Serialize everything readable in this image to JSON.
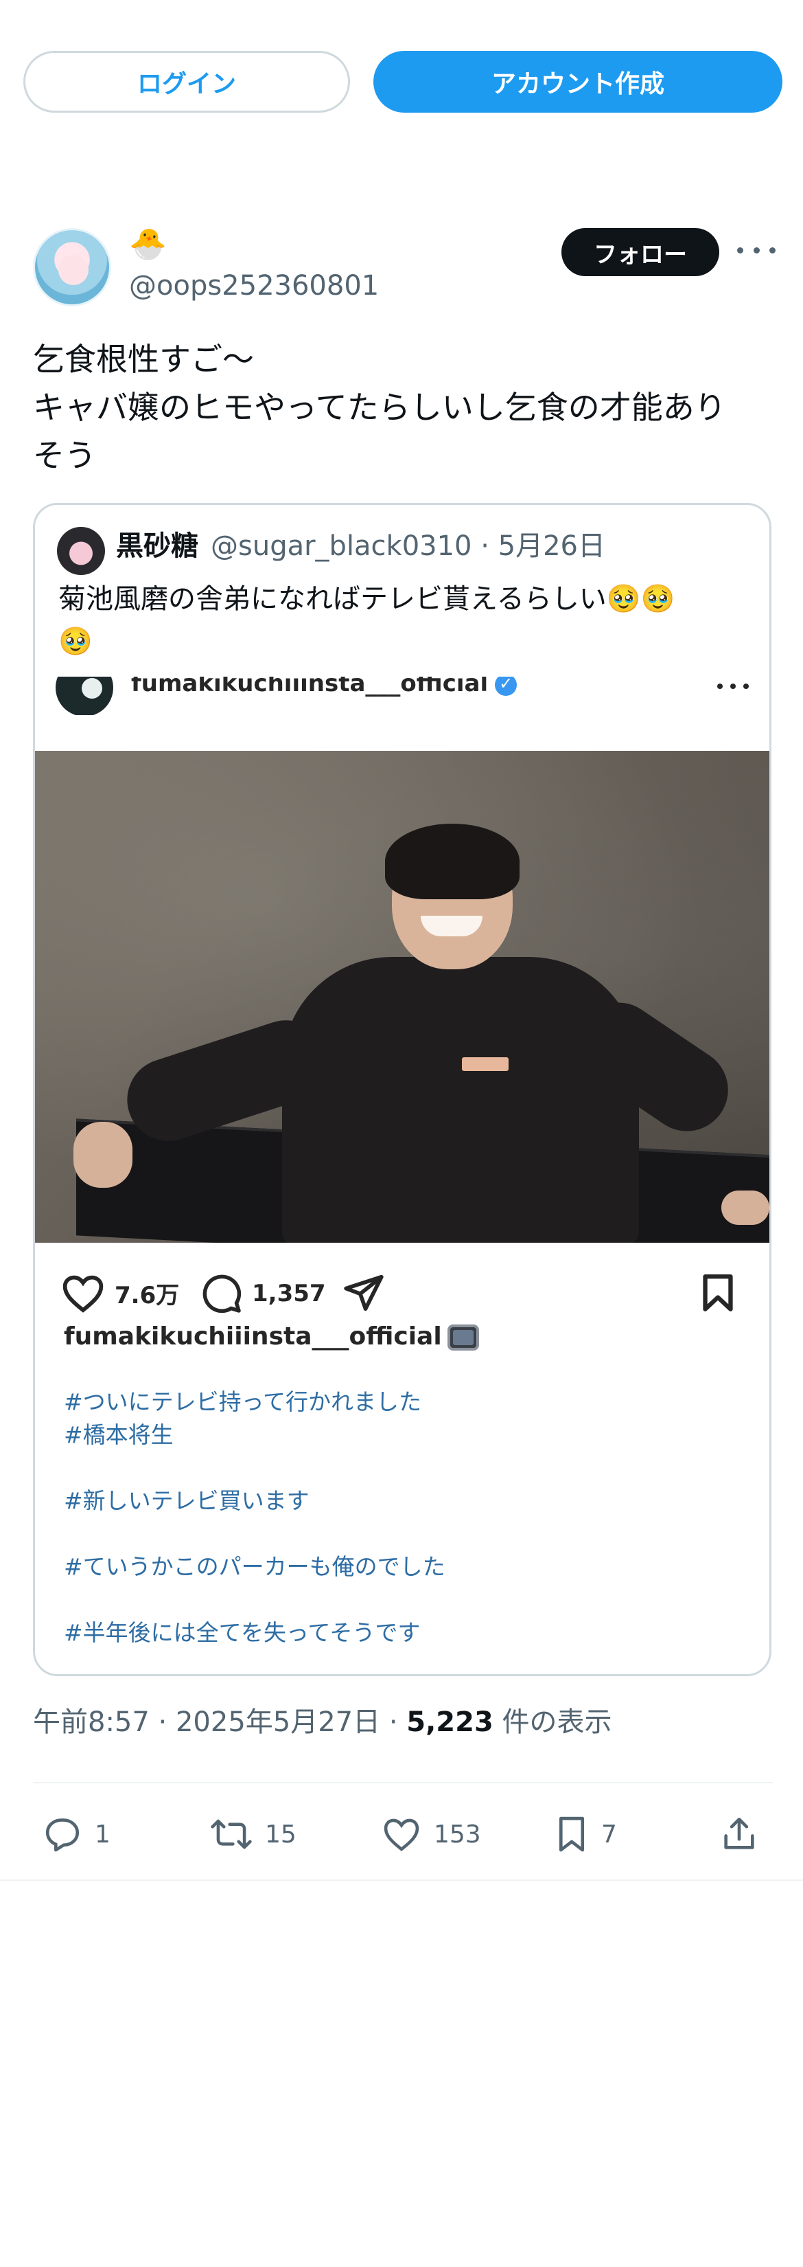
{
  "header": {
    "login_label": "ログイン",
    "signup_label": "アカウント作成"
  },
  "tweet": {
    "display_name": "🐣",
    "handle": "@oops252360801",
    "follow_label": "フォロー",
    "text": "乞食根性すご〜\nキャバ嬢のヒモやってたらしいし乞食の才能あり\nそう",
    "timestamp": "午前8:57 · 2025年5月27日 · ",
    "views_count": "5,223",
    "views_label": " 件の表示",
    "replies": "1",
    "reposts": "15",
    "likes": "153",
    "bookmarks": "7"
  },
  "quote": {
    "name": "黒砂糖",
    "meta": "@sugar_black0310 · 5月26日",
    "text": "菊池風磨の舎弟になればテレビ貰えるらしい🥹🥹\n🥹",
    "insta": {
      "username": "fumakikuchiiinsta___official",
      "likes": "7.6万",
      "comments": "1,357",
      "caption_user": "fumakikuchiiinsta___official",
      "hashtags": [
        "#ついにテレビ持って行かれました",
        "#橋本将生",
        "",
        "#新しいテレビ買います",
        "",
        "#ていうかこのパーカーも俺のでした",
        "",
        "#半年後には全てを失ってそうです"
      ]
    }
  },
  "colors": {
    "accent": "#1d9bf0",
    "text": "#0f1419",
    "muted": "#536471",
    "border": "#cfd9de",
    "hashtag": "#2e6da4"
  }
}
